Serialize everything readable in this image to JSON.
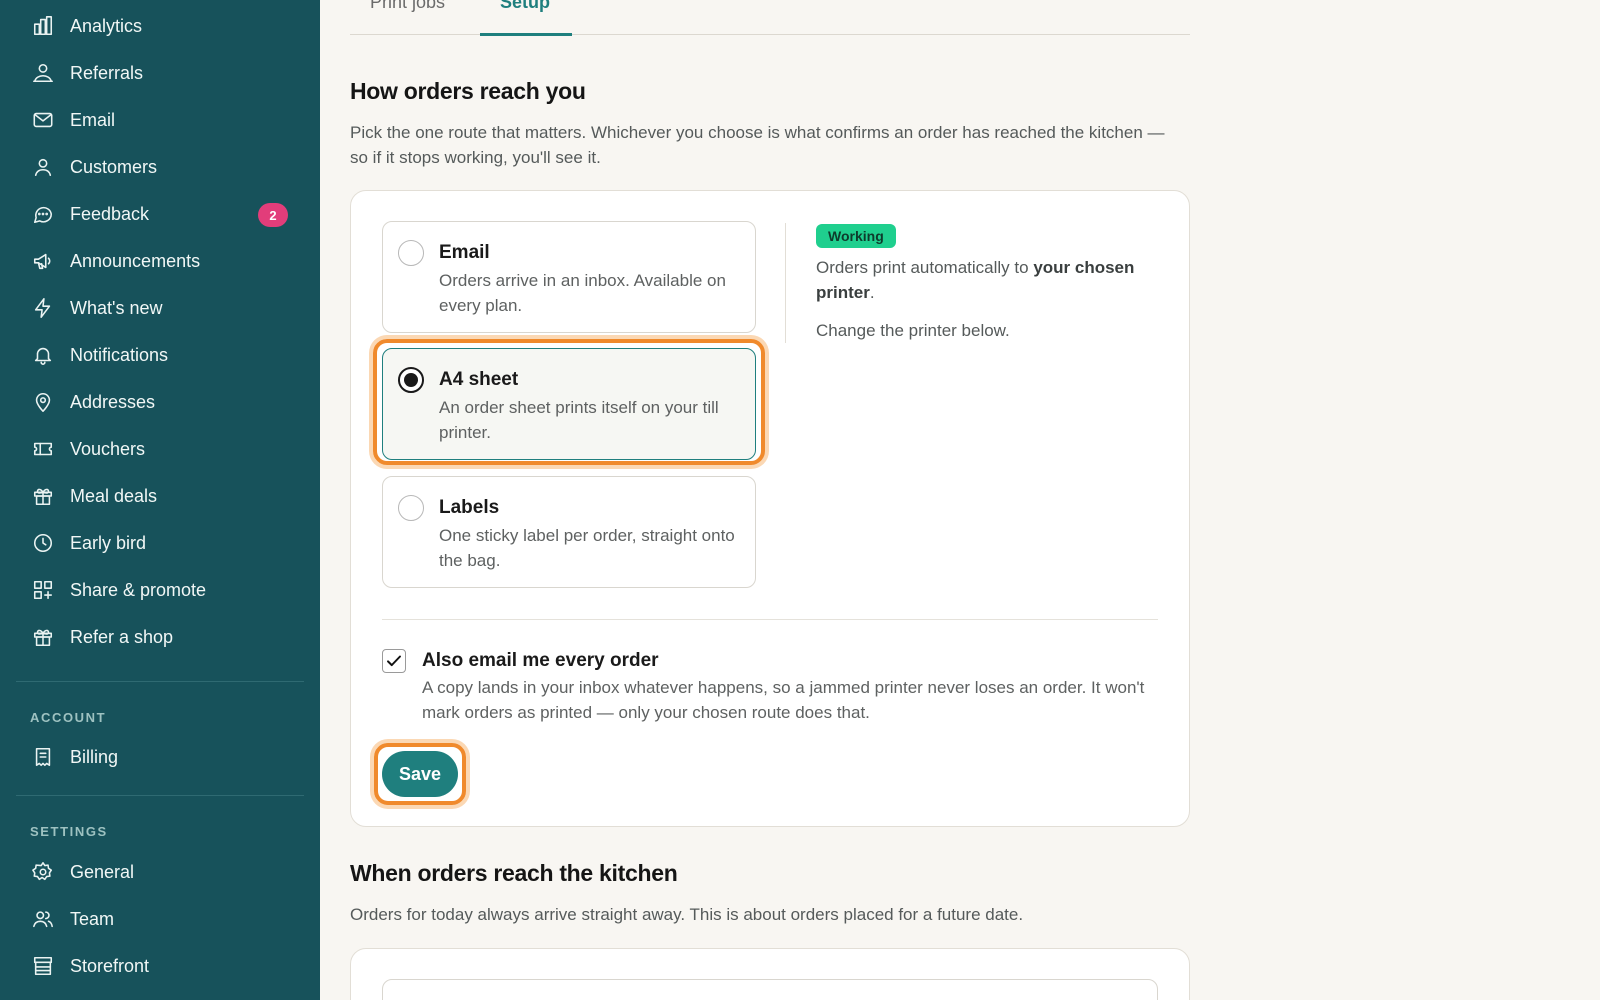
{
  "sidebar": {
    "items": [
      {
        "label": "Analytics",
        "icon": "bar-chart-icon"
      },
      {
        "label": "Referrals",
        "icon": "referrals-icon"
      },
      {
        "label": "Email",
        "icon": "mail-icon"
      },
      {
        "label": "Customers",
        "icon": "user-icon"
      },
      {
        "label": "Feedback",
        "icon": "chat-bubble-icon",
        "badge": "2"
      },
      {
        "label": "Announcements",
        "icon": "megaphone-icon"
      },
      {
        "label": "What's new",
        "icon": "lightning-icon"
      },
      {
        "label": "Notifications",
        "icon": "bell-icon"
      },
      {
        "label": "Addresses",
        "icon": "map-pin-icon"
      },
      {
        "label": "Vouchers",
        "icon": "ticket-icon"
      },
      {
        "label": "Meal deals",
        "icon": "gift-icon"
      },
      {
        "label": "Early bird",
        "icon": "clock-icon"
      },
      {
        "label": "Share & promote",
        "icon": "qr-grid-icon"
      },
      {
        "label": "Refer a shop",
        "icon": "gift-icon"
      }
    ],
    "account_label": "ACCOUNT",
    "account_items": [
      {
        "label": "Billing",
        "icon": "receipt-icon"
      }
    ],
    "settings_label": "SETTINGS",
    "settings_items": [
      {
        "label": "General",
        "icon": "gear-icon"
      },
      {
        "label": "Team",
        "icon": "team-icon"
      },
      {
        "label": "Storefront",
        "icon": "storefront-icon"
      }
    ]
  },
  "tabs": [
    {
      "label": "Print jobs",
      "active": false
    },
    {
      "label": "Setup",
      "active": true
    }
  ],
  "section1": {
    "title": "How orders reach you",
    "lead": "Pick the one route that matters. Whichever you choose is what confirms an order has reached the kitchen — so if it stops working, you'll see it.",
    "options": [
      {
        "title": "Email",
        "desc": "Orders arrive in an inbox. Available on every plan.",
        "selected": false
      },
      {
        "title": "A4 sheet",
        "desc": "An order sheet prints itself on your till printer.",
        "selected": true
      },
      {
        "title": "Labels",
        "desc": "One sticky label per order, straight onto the bag.",
        "selected": false
      }
    ],
    "status": {
      "badge": "Working",
      "text_prefix": "Orders print automatically to ",
      "text_bold": "your chosen printer",
      "text_suffix": ".",
      "hint": "Change the printer below."
    },
    "also_email": {
      "title": "Also email me every order",
      "desc": "A copy lands in your inbox whatever happens, so a jammed printer never loses an order. It won't mark orders as printed — only your chosen route does that.",
      "checked": true
    },
    "save_label": "Save"
  },
  "section2": {
    "title": "When orders reach the kitchen",
    "lead": "Orders for today always arrive straight away. This is about orders placed for a future date."
  },
  "colors": {
    "sidebar_bg": "#17525b",
    "accent": "#1f7f7e",
    "badge": "#e23d7a",
    "focus": "#f08a2c",
    "working": "#1fcf8e"
  }
}
